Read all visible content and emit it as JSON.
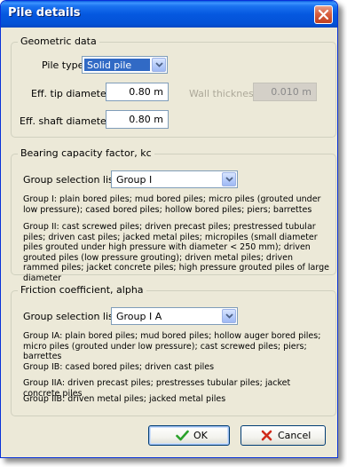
{
  "window": {
    "title": "Pile details"
  },
  "geometric": {
    "legend": "Geometric data",
    "pile_type_label": "Pile type",
    "pile_type_value": "Solid pile",
    "tip_diameter_label": "Eff. tip diameter",
    "tip_diameter_value": "0.80 m",
    "wall_thickness_label": "Wall thickness",
    "wall_thickness_value": "0.010 m",
    "shaft_diameter_label": "Eff. shaft diameter",
    "shaft_diameter_value": "0.80 m"
  },
  "bearing": {
    "legend": "Bearing capacity factor, kc",
    "group_label": "Group selection list",
    "group_value": "Group I",
    "descriptions": [
      "Group I: plain bored piles; mud bored piles; micro piles (grouted under low pressure); cased bored piles; hollow bored piles; piers; barrettes",
      "Group II: cast screwed piles; driven precast piles; prestressed tubular piles; driven cast piles; jacked metal piles; micropiles (small diameter piles grouted under high pressure with diameter < 250 mm); driven grouted piles (low pressure grouting); driven metal piles; driven rammed piles; jacket concrete piles; high pressure grouted piles of large diameter"
    ]
  },
  "friction": {
    "legend": "Friction coefficient, alpha",
    "group_label": "Group selection list",
    "group_value": "Group I A",
    "descriptions": [
      "Group IA: plain bored piles; mud bored piles; hollow auger bored piles; micro piles (grouted under low pressure); cast screwed piles; piers; barrettes",
      "Group IB: cased bored piles; driven cast piles",
      "Group IIA: driven precast piles; prestresses tubular piles; jacket concrete piles",
      "Group IIB: driven metal piles; jacked metal piles"
    ]
  },
  "buttons": {
    "ok_label": "OK",
    "cancel_label": "Cancel"
  },
  "colors": {
    "titlebar": "#0558e0",
    "dialog_bg": "#ece9d8",
    "selection": "#316ac5",
    "ok_check": "#2aa12a",
    "cancel_x": "#d02a1a"
  },
  "icons": {
    "close": "close-icon",
    "dropdown": "chevron-down-icon",
    "ok": "checkmark-icon",
    "cancel": "x-icon"
  }
}
